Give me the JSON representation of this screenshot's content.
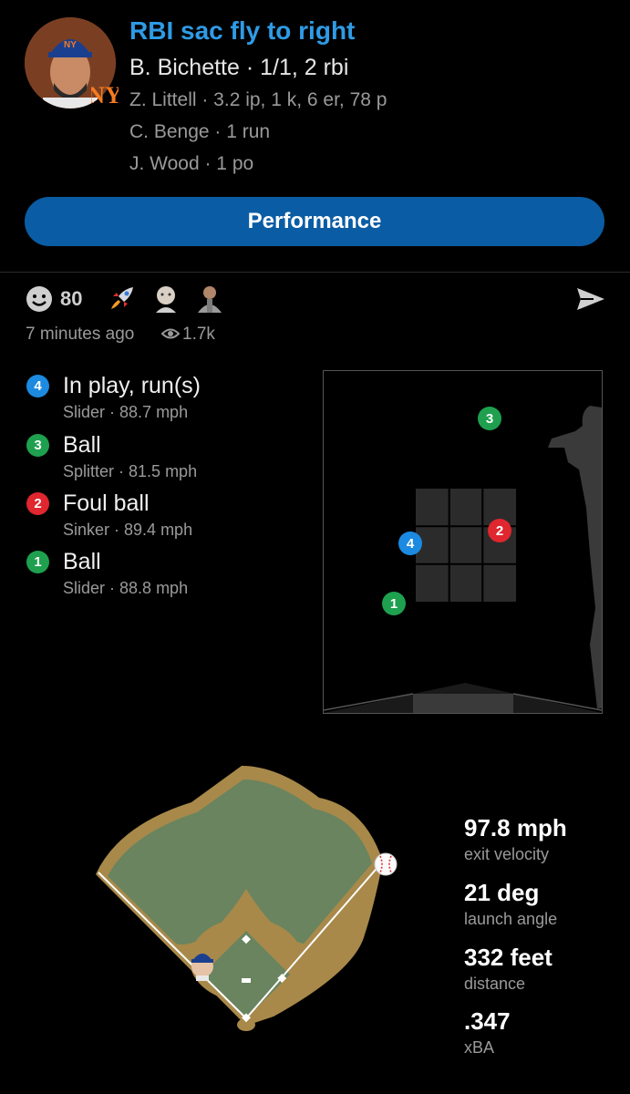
{
  "header": {
    "headline": "RBI sac fly to right",
    "main_line": "B. Bichette · 1/1, 2 rbi",
    "sub_lines": [
      "Z. Littell · 3.2 ip, 1 k, 6 er, 78 p",
      "C. Benge · 1 run",
      "J. Wood · 1 po"
    ],
    "team_logo_text": "NY"
  },
  "performance_button": "Performance",
  "reactions": {
    "count": "80",
    "icons": [
      "smiley-icon",
      "rocket-icon",
      "baby-avatar-icon",
      "player-avatar-icon"
    ],
    "share_icon": "send-icon"
  },
  "meta": {
    "time_ago": "7 minutes ago",
    "views": "1.7k"
  },
  "pitches": [
    {
      "num": "4",
      "color": "#1c8ae0",
      "result": "In play, run(s)",
      "type": "Slider",
      "speed": "88.7 mph"
    },
    {
      "num": "3",
      "color": "#1ea04f",
      "result": "Ball",
      "type": "Splitter",
      "speed": "81.5 mph"
    },
    {
      "num": "2",
      "color": "#e0262e",
      "result": "Foul ball",
      "type": "Sinker",
      "speed": "89.4 mph"
    },
    {
      "num": "1",
      "color": "#1ea04f",
      "result": "Ball",
      "type": "Slider",
      "speed": "88.8 mph"
    }
  ],
  "stats": [
    {
      "value": "97.8 mph",
      "label": "exit velocity"
    },
    {
      "value": "21 deg",
      "label": "launch angle"
    },
    {
      "value": "332 feet",
      "label": "distance"
    },
    {
      "value": ".347",
      "label": "xBA"
    }
  ]
}
